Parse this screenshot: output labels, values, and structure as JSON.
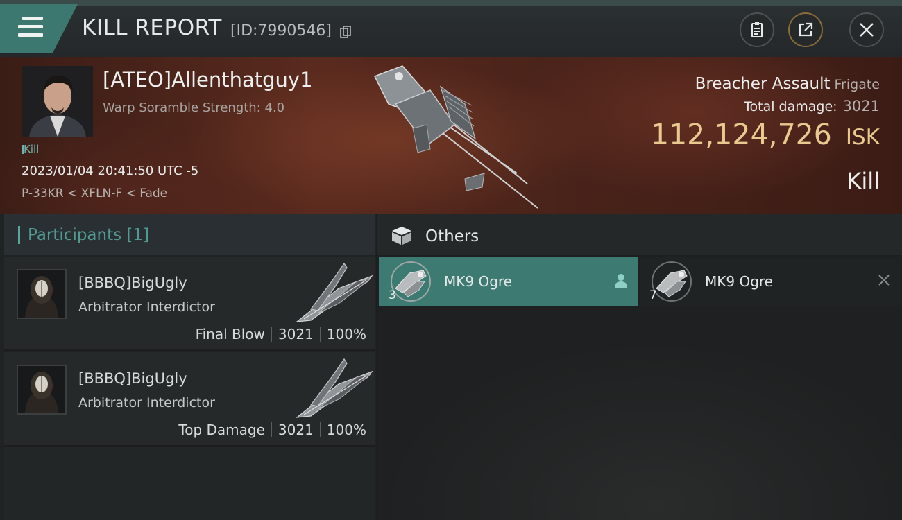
{
  "header": {
    "title": "KILL REPORT",
    "report_id": "[ID:7990546]",
    "icons": [
      "menu-icon",
      "copy-icon",
      "clipboard-icon",
      "share-icon",
      "close-icon"
    ]
  },
  "victim": {
    "name": "[ATEO]Allenthatguy1",
    "subtitle": "Warp Soramble Strength: 4.0",
    "kill_tag": "Kill",
    "datetime": "2023/01/04 20:41:50 UTC -5",
    "location": "P-33KR < XFLN-F < Fade"
  },
  "ship": {
    "name": "Breacher Assault",
    "class": "Frigate",
    "total_damage_label": "Total damage:",
    "total_damage": "3021",
    "isk_value": "112,124,726",
    "isk_unit": "ISK",
    "result": "Kill"
  },
  "participants": {
    "label": "Participants [1]",
    "rows": [
      {
        "name": "[BBBQ]BigUgly",
        "ship": "Arbitrator Interdictor",
        "role": "Final Blow",
        "damage": "3021",
        "percent": "100%"
      },
      {
        "name": "[BBBQ]BigUgly",
        "ship": "Arbitrator Interdictor",
        "role": "Top Damage",
        "damage": "3021",
        "percent": "100%"
      }
    ]
  },
  "others": {
    "label": "Others",
    "items": [
      {
        "name": "MK9 Ogre",
        "qty": "3",
        "action_icon": "person-icon"
      },
      {
        "name": "MK9 Ogre",
        "qty": "7",
        "action_icon": "close-x-icon"
      }
    ]
  },
  "colors": {
    "accent_teal": "#3d7870",
    "isk_gold": "#e9c98f",
    "participants_label": "#4f9a91"
  }
}
